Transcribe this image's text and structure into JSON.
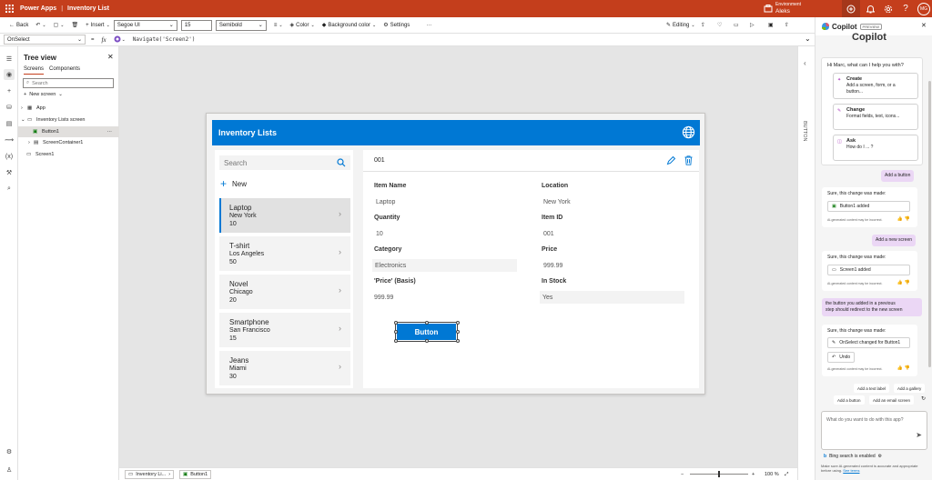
{
  "topbar": {
    "brand": "Power Apps",
    "separator": "|",
    "title": "Inventory List",
    "env_label": "Environment",
    "env_name": "Aleks",
    "avatar": "MG"
  },
  "cmdbar": {
    "back": "Back",
    "insert": "Insert",
    "font": "Segoe UI",
    "size": "15",
    "weight": "Semibold",
    "color": "Color",
    "bgcolor": "Background color",
    "settings": "Settings",
    "more": "···",
    "editing": "Editing"
  },
  "formula": {
    "property": "OnSelect",
    "fx": "fx",
    "equals": "=",
    "code": "Navigate('Screen2')"
  },
  "tree": {
    "title": "Tree view",
    "tab_screens": "Screens",
    "tab_components": "Components",
    "search": "Search",
    "new_screen": "New screen",
    "rows": [
      "App",
      "Inventory Lists screen",
      "Button1",
      "ScreenContainer1",
      "Screen1"
    ],
    "row_more": "···"
  },
  "app": {
    "title": "Inventory Lists",
    "search_placeholder": "Search",
    "new_label": "New",
    "items": [
      {
        "name": "Laptop",
        "city": "New York",
        "qty": "10"
      },
      {
        "name": "T-shirt",
        "city": "Los Angeles",
        "qty": "50"
      },
      {
        "name": "Novel",
        "city": "Chicago",
        "qty": "20"
      },
      {
        "name": "Smartphone",
        "city": "San Francisco",
        "qty": "15"
      },
      {
        "name": "Jeans",
        "city": "Miami",
        "qty": "30"
      }
    ],
    "form": {
      "id": "001",
      "fields": [
        {
          "label": "Item Name",
          "value": "Laptop"
        },
        {
          "label": "Location",
          "value": "New York"
        },
        {
          "label": "Quantity",
          "value": "10"
        },
        {
          "label": "Item ID",
          "value": "001"
        },
        {
          "label": "Category",
          "value": "Electronics"
        },
        {
          "label": "Price",
          "value": "999.99"
        },
        {
          "label": "'Price' (Basis)",
          "value": "999.99"
        },
        {
          "label": "In Stock",
          "value": "Yes"
        }
      ],
      "button": "Button"
    }
  },
  "props_strip": {
    "label": "BUTTON"
  },
  "status": {
    "screen_tab": "Inventory Li...",
    "button_tab": "Button1",
    "zoom": "100 %"
  },
  "copilot": {
    "title": "Copilot",
    "badge": "PREVIEW",
    "big_title": "Copilot",
    "greeting": "Hi Marc, what can I help you with?",
    "suggestions": [
      {
        "head": "Create",
        "body1": "Add a screen, form, or a",
        "body2": "button..."
      },
      {
        "head": "Change",
        "body1": "Format fields, text, icons...",
        "body2": ""
      },
      {
        "head": "Ask",
        "body1": "How do I ... ?",
        "body2": ""
      }
    ],
    "user1": "Add a button",
    "made": "Sure, this change was made:",
    "chip1": "Button1 added",
    "disclaimer": "AI-generated content may be incorrect.",
    "user2": "Add a new screen",
    "chip2": "Screen1 added",
    "user3a": "the button you added in a previous",
    "user3b": "step should redirect to the new screen",
    "chip3": "OnSelect changed for Button1",
    "undo": "Undo",
    "pills": [
      "Add a text label",
      "Add a gallery",
      "Add a button",
      "Add an email screen"
    ],
    "input_placeholder": "What do you want to do with this app?",
    "bing": "Bing search is enabled",
    "disc2a": "Make sure AI-generated content is accurate and appropriate",
    "disc2b": "before using.",
    "see_terms": "See terms"
  }
}
